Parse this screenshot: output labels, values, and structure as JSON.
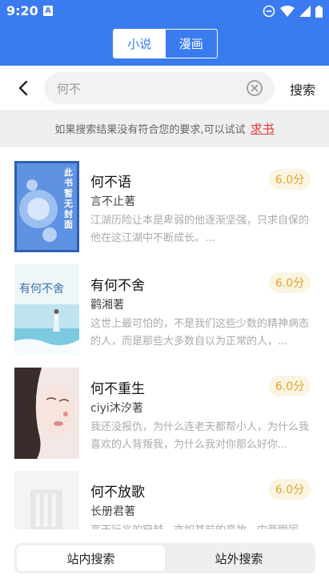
{
  "status_bar": {
    "time": "9:20",
    "a_badge": "A"
  },
  "header": {
    "tabs": [
      {
        "label": "小说"
      },
      {
        "label": "漫画"
      }
    ]
  },
  "search": {
    "value": "何不",
    "button_label": "搜索"
  },
  "hint": {
    "text": "如果搜索结果没有符合您的要求,可以试试",
    "link": "求书"
  },
  "books": [
    {
      "title": "何不语",
      "author": "言不止著",
      "score": "6.0分",
      "description": "江湖历险让本是卑弱的他逐渐坚强，只求自保的他在这江湖中不断成长。...",
      "cover_text": [
        "此",
        "书",
        "暂",
        "无",
        "封",
        "面"
      ]
    },
    {
      "title": "有何不舍",
      "author": "鹳湘著",
      "score": "6.0分",
      "description": "这世上最可怕的，不是我们这些少数的精神病态的人，而是那些大多数自以为正常的人，...",
      "cover_text": [
        "有何不舍"
      ]
    },
    {
      "title": "何不重生",
      "author": "ciyi沐汐著",
      "score": "6.0分",
      "description": "我还没报仇，为什么连老天都帮小人，为什么我喜欢的人背叛我，为什么我对你那么好你...",
      "cover_text": []
    },
    {
      "title": "何不放歌",
      "author": "长册君著",
      "score": "6.0分",
      "description": "高天行兆的穿越，亦如其前的变故，中两眼同...",
      "cover_text": []
    }
  ],
  "bottom_tabs": [
    {
      "label": "站内搜索"
    },
    {
      "label": "站外搜索"
    }
  ],
  "colors": {
    "primary": "#3a7bf0",
    "score_text": "#e0a52a",
    "link": "#e33a3a"
  }
}
